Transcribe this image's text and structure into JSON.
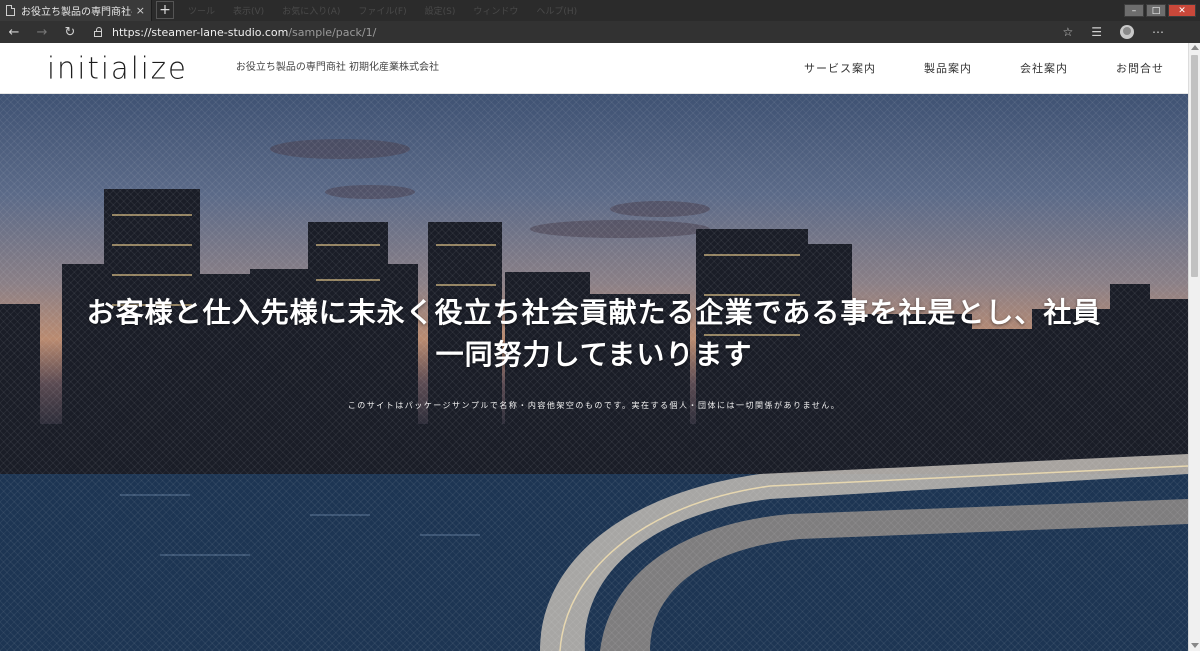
{
  "browser": {
    "tab_title": "お役立ち製品の専門商社-初期化",
    "tab_close": "×",
    "new_tab": "+",
    "url_host": "https://steamer-lane-studio.com",
    "url_path": "/sample/pack/1/",
    "menu_items": [
      "ツール",
      "表示(V)",
      "お気に入り(A)",
      "ファイル(F)",
      "設定(S)",
      "ウィンドウ",
      "ヘルプ(H)"
    ]
  },
  "site": {
    "logo": "initialize",
    "tagline": "お役立ち製品の専門商社 初期化産業株式会社",
    "nav": [
      {
        "label": "サービス案内"
      },
      {
        "label": "製品案内"
      },
      {
        "label": "会社案内"
      },
      {
        "label": "お問合せ"
      }
    ]
  },
  "hero": {
    "headline_line1": "お客様と仕入先様に末永く役立ち社会貢献たる企業である事を社是とし、社員",
    "headline_line2": "一同努力してまいります",
    "disclaimer": "このサイトはパッケージサンプルで名称・内容他架空のものです。実在する個人・団体には一切関係がありません。"
  },
  "colors": {
    "header_bg": "#ffffff",
    "chrome_bg": "#2b2b2b",
    "address_bg": "#323232",
    "hero_text": "#ffffff"
  }
}
